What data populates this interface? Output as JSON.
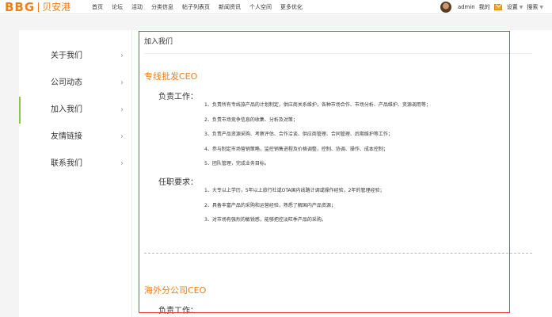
{
  "header": {
    "logo_en": "BBG",
    "logo_cn": "贝安港",
    "nav": [
      "首页",
      "论坛",
      "活动",
      "分类信息",
      "帖子列表页",
      "新闻资讯",
      "个人空间",
      "更多优化"
    ],
    "user": {
      "username": "admin",
      "my": "我的",
      "settings": "设置",
      "search": "搜索"
    }
  },
  "sidebar": {
    "items": [
      {
        "label": "关于我们"
      },
      {
        "label": "公司动态"
      },
      {
        "label": "加入我们"
      },
      {
        "label": "友情链接"
      },
      {
        "label": "联系我们"
      }
    ],
    "chevron": "›"
  },
  "main": {
    "breadcrumb": "加入我们",
    "jobs": [
      {
        "title": "专线批发CEO",
        "duties_label": "负责工作：",
        "duties": [
          "1、负责所有专线旅产品的计划制定，供应商关系维护，各种市场合作、市场分析、产品维护、资源调用等；",
          "2、负责市场竞争信息的收集、分析及对策；",
          "3、负责产品资源采购、考察评估、合作洽谈、供应商管理、合同管理、后期维护等工作；",
          "4、参与制定市场营销策略，监控销售进程及价格调整，控制、协调、操作、成本控制；",
          "5、团队管理，完成业务目标。"
        ],
        "requirements_label": "任职要求：",
        "requirements": [
          "1、大专以上学历，5年以上旅行社或OTA国内线路计调或操作经验，2年的管理经验；",
          "2、具备丰富产品的采购和运营经验，熟悉了解国内产品资源；",
          "3、对市场有强烈的敏锐感，能够把控淡旺季产品的采购。"
        ]
      },
      {
        "title": "海外分公司CEO",
        "duties_label": "负责工作："
      }
    ]
  },
  "colors": {
    "brand_orange": "#f07f1a",
    "active_green": "#8dc63f",
    "highlight_red": "#e8353b"
  }
}
